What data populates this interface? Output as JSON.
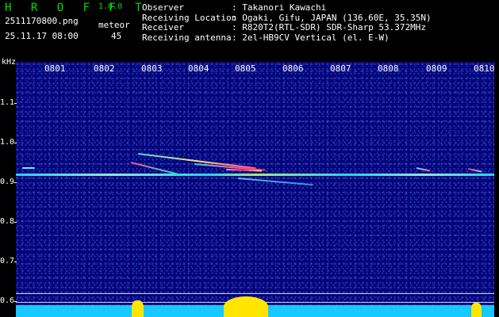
{
  "header": {
    "logo": "H R O F F T",
    "version": "1.0.0",
    "filename": "2511170800.png",
    "datetime": "25.11.17 08:00",
    "meteor_label": "meteor",
    "meteor_count": "45"
  },
  "station": [
    {
      "key": "Observer",
      "value": ": Takanori Kawachi"
    },
    {
      "key": "Receiving Location",
      "value": ": Ogaki, Gifu, JAPAN (136.60E, 35.35N)"
    },
    {
      "key": "Receiver",
      "value": ": R820T2(RTL-SDR) SDR-Sharp 53.372MHz"
    },
    {
      "key": "Receiving antenna",
      "value": ": 2el-HB9CV Vertical (el. E-W)"
    }
  ],
  "axes": {
    "freq_unit": "kHz",
    "freq_labels": [
      "1.1",
      "1.0",
      "0.9",
      "0.8",
      "0.7",
      "0.6"
    ],
    "time_labels": [
      "0801",
      "0802",
      "0803",
      "0804",
      "0805",
      "0806",
      "0807",
      "0808",
      "0809",
      "0810"
    ]
  },
  "colors": {
    "background": "#04047a",
    "carrier": "#2de4ff",
    "logo": "#00e000",
    "activity_bar": "#ffe500",
    "baseline": "#18c8ff"
  }
}
